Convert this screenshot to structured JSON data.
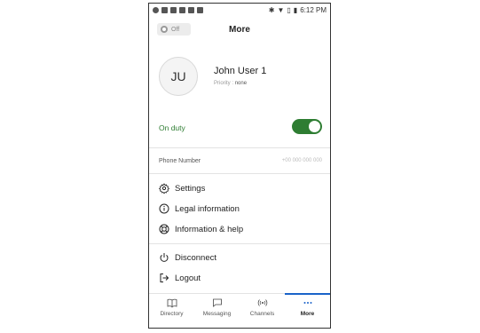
{
  "status_bar": {
    "time": "6:12 PM"
  },
  "header": {
    "title": "More",
    "presence_toggle_label": "Off"
  },
  "profile": {
    "initials": "JU",
    "name": "John User 1",
    "priority_label": "Priority :",
    "priority_value": "none"
  },
  "duty": {
    "label": "On duty",
    "enabled": true
  },
  "phone": {
    "label": "Phone Number",
    "value": "+00 000 000 000"
  },
  "menu": {
    "settings": "Settings",
    "legal": "Legal information",
    "help": "Information & help",
    "disconnect": "Disconnect",
    "logout": "Logout"
  },
  "bottom_nav": {
    "directory": "Directory",
    "messaging": "Messaging",
    "channels": "Channels",
    "more": "More"
  },
  "colors": {
    "accent_green": "#2e7d32",
    "active_tab_blue": "#1a63c9"
  }
}
